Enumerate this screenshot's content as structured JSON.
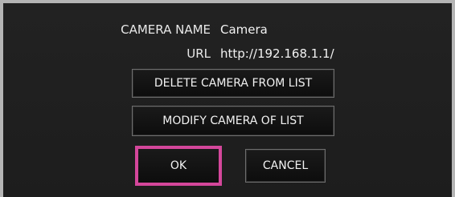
{
  "camera": {
    "name_label": "CAMERA NAME",
    "name_value": "Camera",
    "url_label": "URL",
    "url_value": "http://192.168.1.1/"
  },
  "buttons": {
    "delete_label": "DELETE CAMERA FROM LIST",
    "modify_label": "MODIFY CAMERA OF LIST",
    "ok_label": "OK",
    "cancel_label": "CANCEL"
  },
  "colors": {
    "background": "#1d1d1d",
    "frame": "#b5b5b5",
    "ok_highlight": "#d4479b",
    "text": "#f2f2f2"
  }
}
